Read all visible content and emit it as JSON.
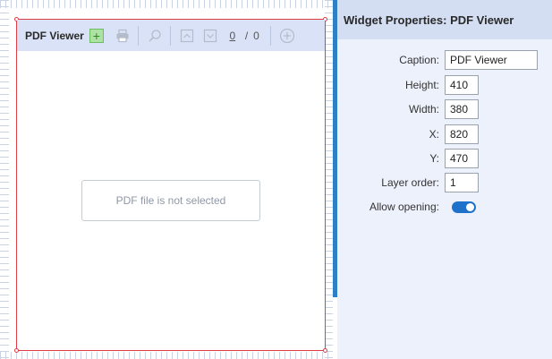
{
  "pdf_viewer": {
    "title": "PDF Viewer",
    "page_current": "0",
    "page_separator": "/",
    "page_total": "0",
    "empty_message": "PDF file is not selected"
  },
  "properties": {
    "header": "Widget Properties: PDF Viewer",
    "rows": [
      {
        "label": "Caption:",
        "value": "PDF Viewer"
      },
      {
        "label": "Height:",
        "value": "410"
      },
      {
        "label": "Width:",
        "value": "380"
      },
      {
        "label": "X:",
        "value": "820"
      },
      {
        "label": "Y:",
        "value": "470"
      },
      {
        "label": "Layer order:",
        "value": "1"
      },
      {
        "label": "Allow opening:",
        "value": "on"
      }
    ]
  },
  "colors": {
    "selection_border": "#e03b46",
    "toolbar_bg": "#d9e2f6",
    "accent": "#2d7fc7",
    "toggle_on": "#1f72c9"
  }
}
